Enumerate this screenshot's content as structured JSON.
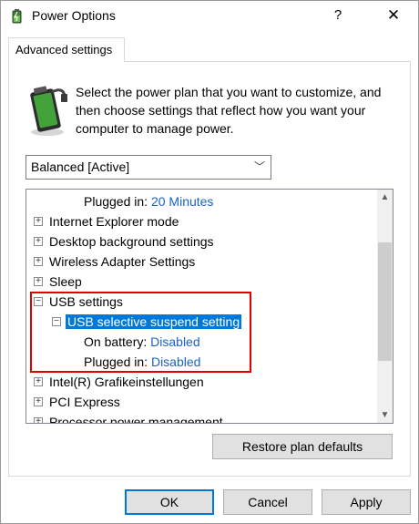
{
  "window": {
    "title": "Power Options",
    "help_glyph": "?",
    "close_glyph": "✕",
    "icon": "power-options-icon"
  },
  "tab": {
    "label": "Advanced settings"
  },
  "description": "Select the power plan that you want to customize, and then choose settings that reflect how you want your computer to manage power.",
  "plan_select": {
    "value": "Balanced [Active]",
    "chevron": "﹀"
  },
  "tree": {
    "rows": [
      {
        "name": "plugged-in-sleep",
        "label": "Plugged in:",
        "value": "20 Minutes"
      },
      {
        "name": "internet-explorer-mode",
        "label": "Internet Explorer mode",
        "toggle": "+"
      },
      {
        "name": "desktop-background-settings",
        "label": "Desktop background settings",
        "toggle": "+"
      },
      {
        "name": "wireless-adapter-settings",
        "label": "Wireless Adapter Settings",
        "toggle": "+"
      },
      {
        "name": "sleep",
        "label": "Sleep",
        "toggle": "+"
      },
      {
        "name": "usb-settings",
        "label": "USB settings",
        "toggle": "−"
      },
      {
        "name": "usb-selective-suspend-setting",
        "label": "USB selective suspend setting",
        "toggle": "−"
      },
      {
        "name": "on-battery",
        "label": "On battery:",
        "value": "Disabled"
      },
      {
        "name": "plugged-in-usb",
        "label": "Plugged in:",
        "value": "Disabled"
      },
      {
        "name": "intel-grafikeinstellungen",
        "label": "Intel(R) Grafikeinstellungen",
        "toggle": "+"
      },
      {
        "name": "pci-express",
        "label": "PCI Express",
        "toggle": "+"
      },
      {
        "name": "processor-power-management",
        "label": "Processor power management",
        "toggle": "+"
      }
    ]
  },
  "scroll": {
    "up": "▲",
    "down": "▼"
  },
  "buttons": {
    "restore": "Restore plan defaults",
    "ok": "OK",
    "cancel": "Cancel",
    "apply": "Apply"
  },
  "colors": {
    "link": "#1a63c9",
    "selection": "#0078d7",
    "highlight": "#e00000"
  }
}
